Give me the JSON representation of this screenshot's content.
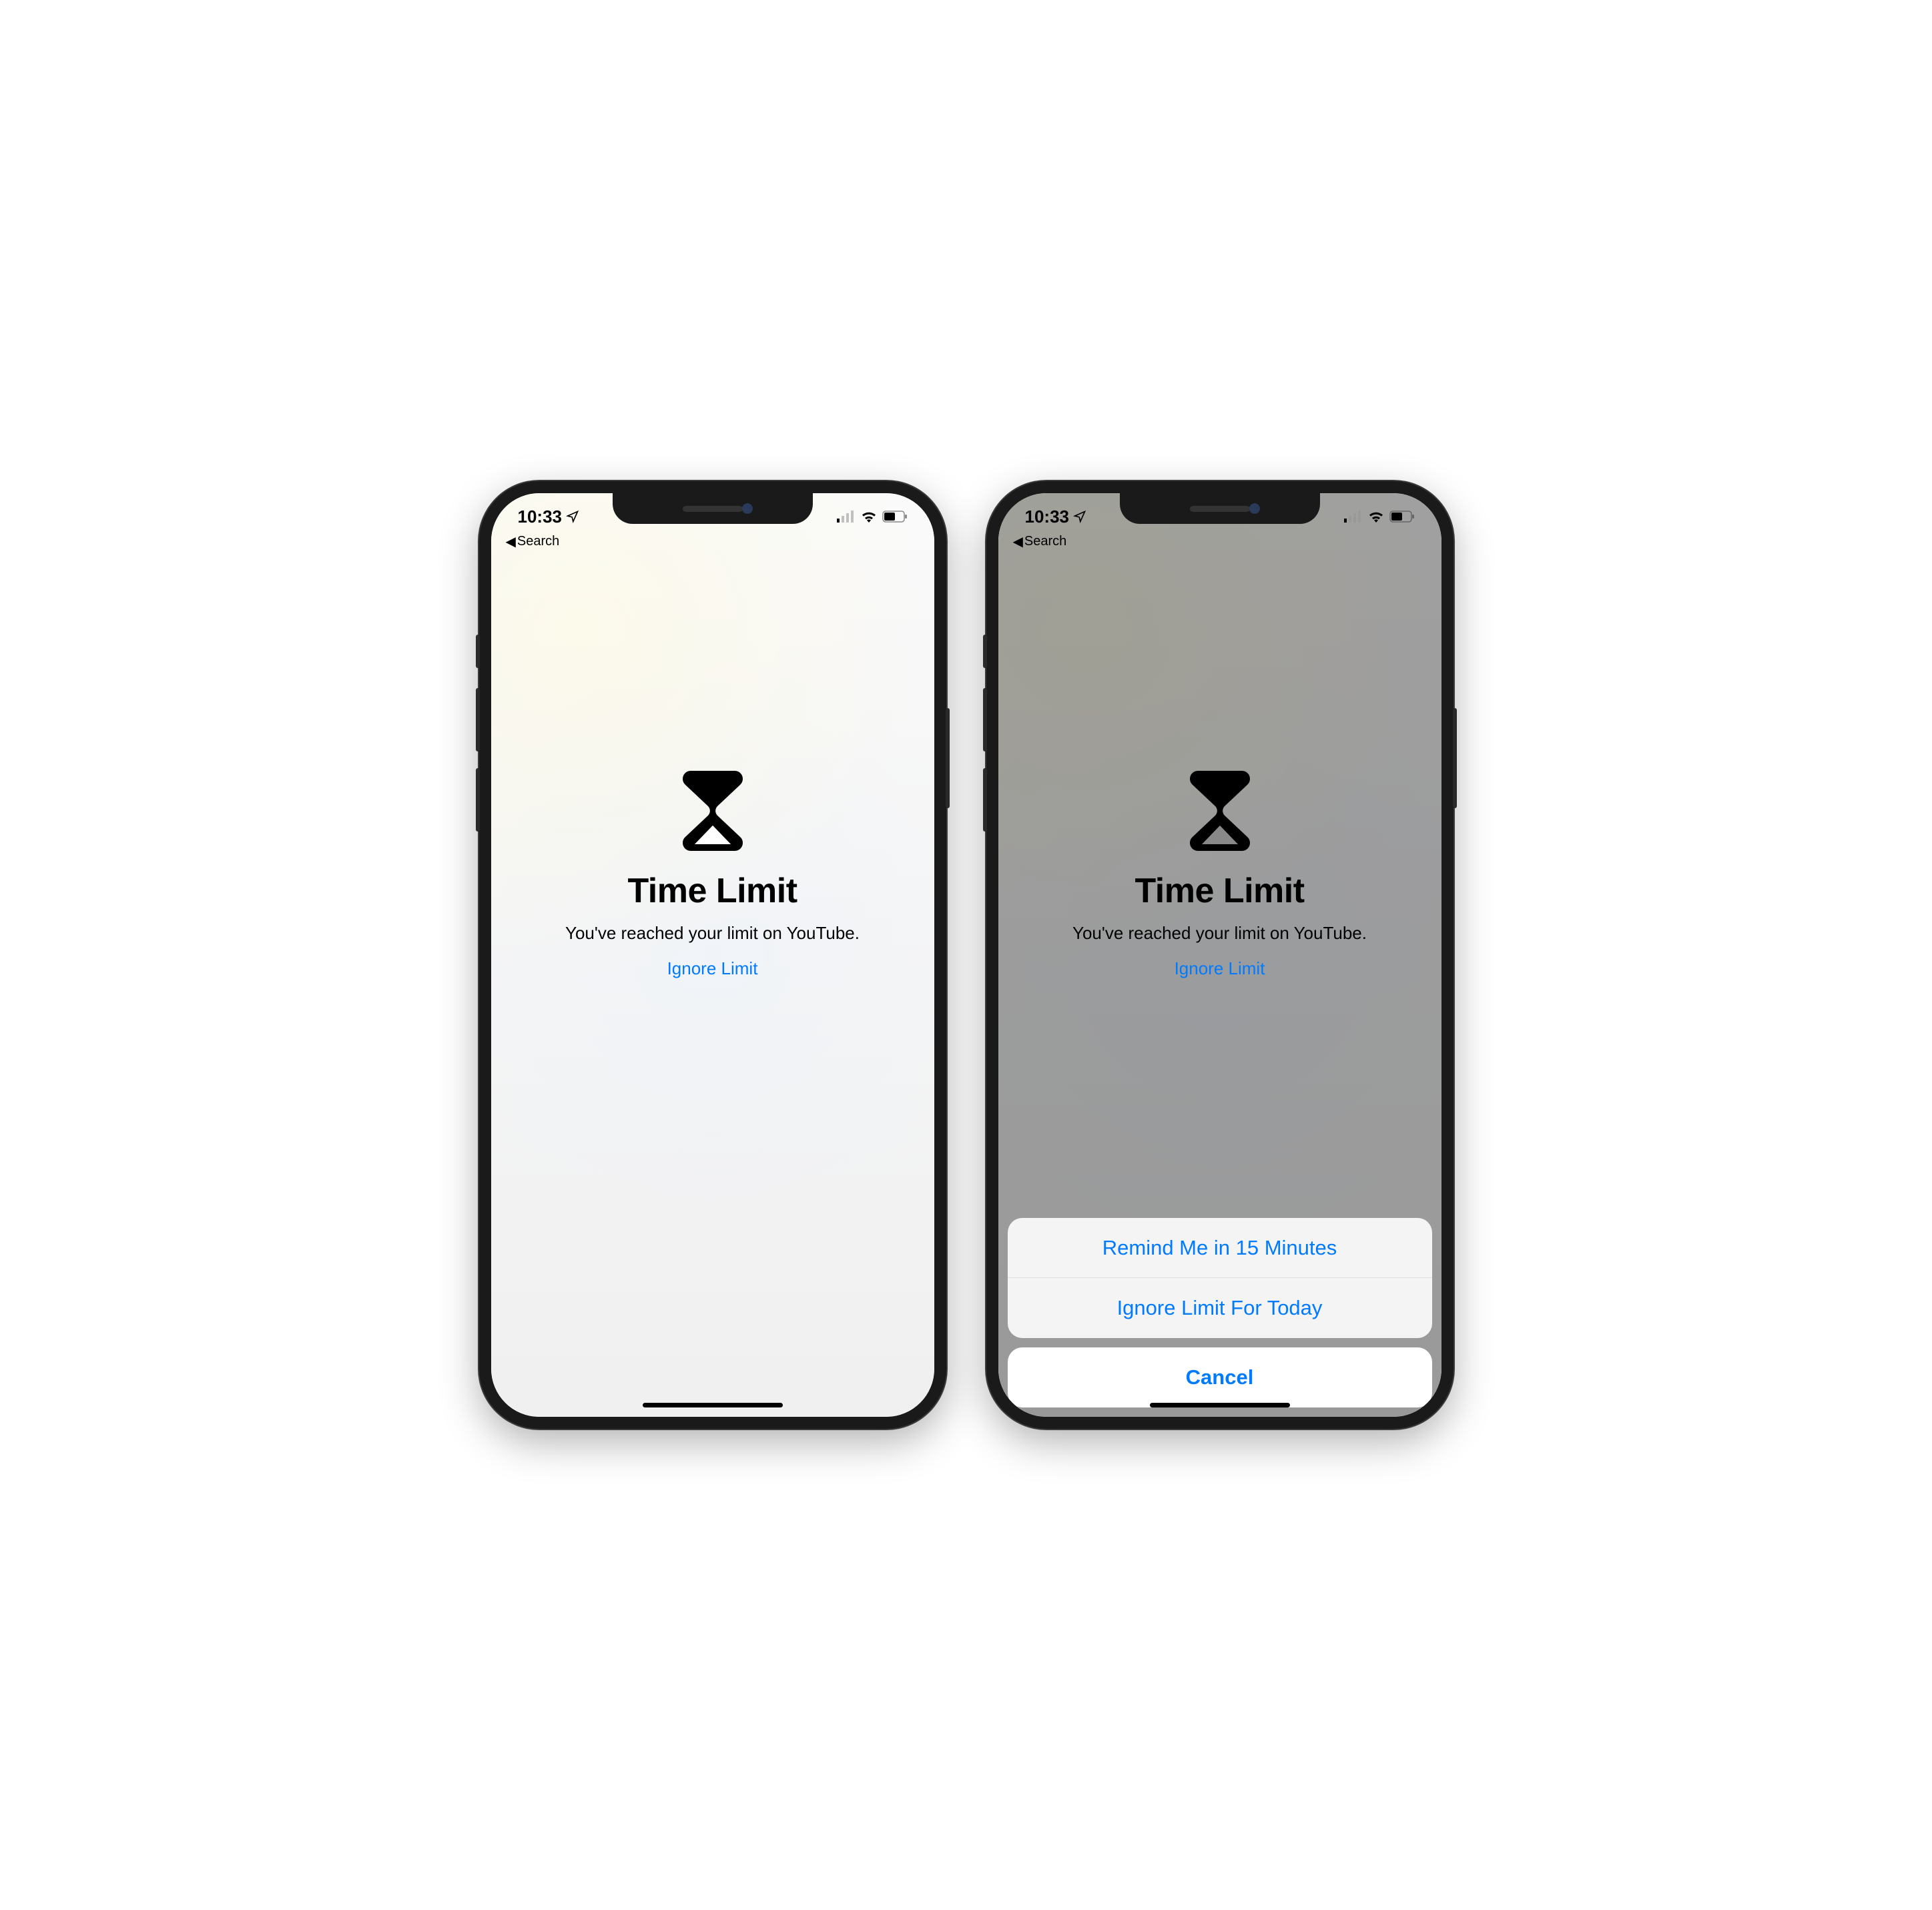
{
  "status": {
    "time": "10:33",
    "back_label": "Search"
  },
  "screen": {
    "title": "Time Limit",
    "subtitle": "You've reached your limit on YouTube.",
    "ignore_link": "Ignore Limit"
  },
  "action_sheet": {
    "option_remind": "Remind Me in 15 Minutes",
    "option_ignore": "Ignore Limit For Today",
    "cancel": "Cancel"
  }
}
